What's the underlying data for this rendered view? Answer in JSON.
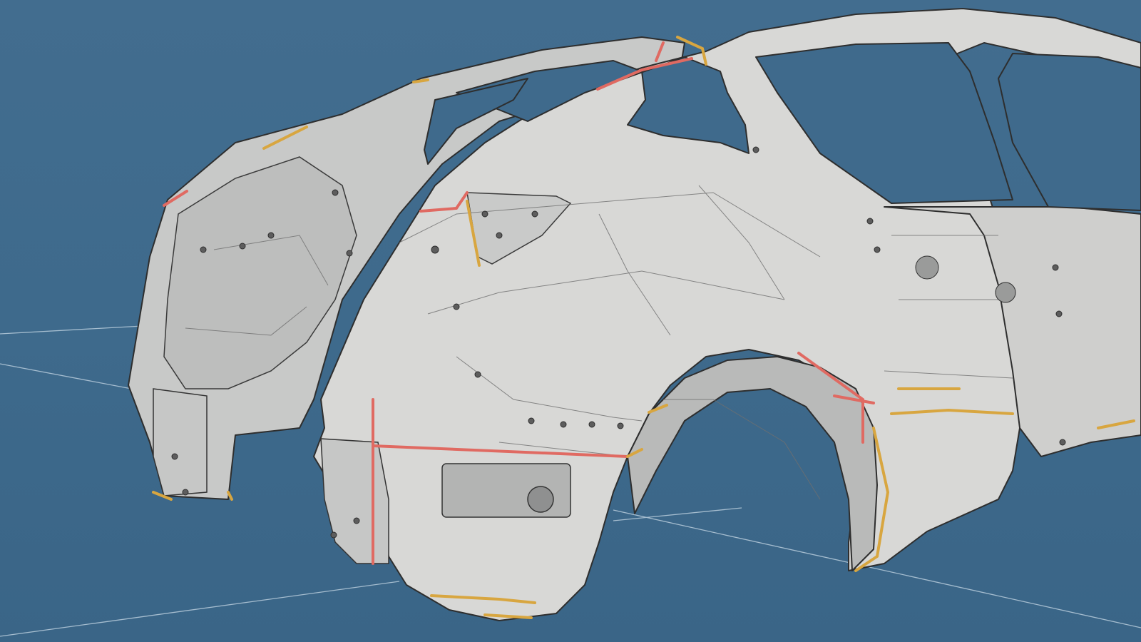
{
  "viewport": {
    "background_color": "#3f6a8c",
    "body_color": "#d6d6d4",
    "body_shadow_color": "#a9aaa9",
    "edge_color": "#2e2e2e",
    "weld_red": "#e06a62",
    "weld_yellow": "#d8a640",
    "grid_line_color": "#b9cddc"
  }
}
